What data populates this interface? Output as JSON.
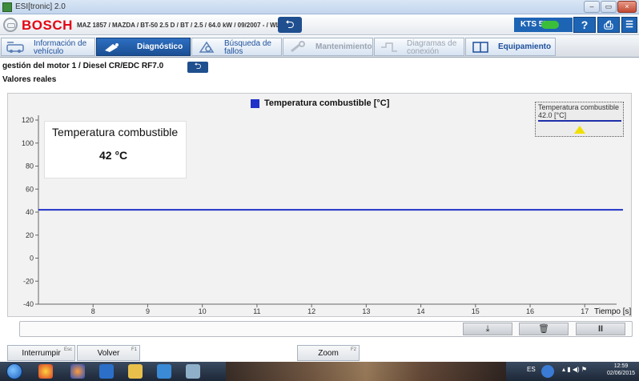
{
  "window": {
    "title": "ESI[tronic] 2.0",
    "controls": [
      "–",
      "▭",
      "×"
    ]
  },
  "header": {
    "brand": "BOSCH",
    "vehicle": "MAZ 1857 / MAZDA / BT-50 2.5 D / BT / 2.5 / 64.0 kW / 09/2007 - / WL",
    "back_symbol": "⮌",
    "device": "KTS 570",
    "help_label": "?",
    "print_label": "⎙",
    "menu_label": "☰"
  },
  "tabs": [
    {
      "line1": "Información de",
      "line2": "vehículo",
      "icon": "car-info-icon",
      "state": "normal"
    },
    {
      "line1": "Diagnóstico",
      "line2": "",
      "icon": "stethoscope-icon",
      "state": "active"
    },
    {
      "line1": "Búsqueda de",
      "line2": "fallos",
      "icon": "fault-search-icon",
      "state": "normal"
    },
    {
      "line1": "Mantenimiento",
      "line2": "",
      "icon": "wrench-icon",
      "state": "disabled"
    },
    {
      "line1": "Diagramas de",
      "line2": "conexión",
      "icon": "wiring-diagram-icon",
      "state": "disabled"
    },
    {
      "line1": "Equipamiento",
      "line2": "",
      "icon": "book-icon",
      "state": "normal"
    }
  ],
  "path": {
    "text": "gestión del motor 1 / Diesel CR/EDC RF7.0",
    "back_symbol": "⮌"
  },
  "subtitle": "Valores reales",
  "chart_data": {
    "type": "line",
    "legend": "Temperatura combustible [°C]",
    "xlabel": "Tiempo [s]",
    "ylabel": "",
    "xlim": [
      7.0,
      17.7
    ],
    "ylim": [
      -40,
      120
    ],
    "x_ticks": [
      8,
      9,
      10,
      11,
      12,
      13,
      14,
      15,
      16,
      17
    ],
    "y_ticks": [
      120,
      100,
      80,
      60,
      40,
      20,
      0,
      -20,
      -40
    ],
    "grid": false,
    "series": [
      {
        "name": "Temperatura combustible [°C]",
        "color": "#2032c8",
        "x": [
          7.0,
          17.7
        ],
        "y": [
          42,
          42
        ]
      }
    ]
  },
  "tooltip": {
    "name": "Temperatura combustible",
    "value": "42.0 [°C]"
  },
  "value_card": {
    "name": "Temperatura combustible",
    "value": "42 °C"
  },
  "controls": {
    "zoom_fit": "⤓",
    "delete": "🗑",
    "pause": "II"
  },
  "bottom": {
    "interrupt": "Interrumpir",
    "interrupt_key": "Esc",
    "back": "Volver",
    "back_key": "F1",
    "zoom": "Zoom",
    "zoom_key": "F2"
  },
  "taskbar": {
    "lang": "ES",
    "time": "12:59",
    "date": "02/06/2015"
  }
}
